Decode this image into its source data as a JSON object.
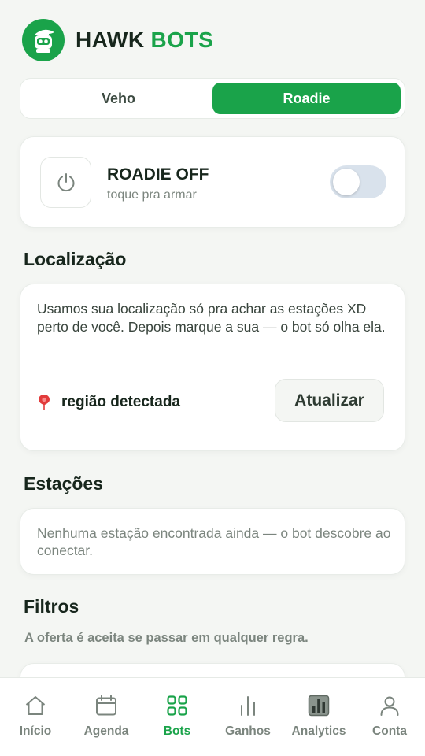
{
  "brand": {
    "name_part1": "HAWK",
    "name_part2": "BOTS",
    "logo_icon": "robot-hawk-icon"
  },
  "tabs": [
    {
      "label": "Veho",
      "active": false
    },
    {
      "label": "Roadie",
      "active": true
    }
  ],
  "power": {
    "title": "ROADIE OFF",
    "subtitle": "toque pra armar",
    "toggle_on": false,
    "icon": "power-icon"
  },
  "location": {
    "title": "Localização",
    "description": "Usamos sua localização só pra achar as estações XD perto de você. Depois marque a sua — o bot só olha ela.",
    "region": "região detectada",
    "update_label": "Atualizar"
  },
  "stations": {
    "title": "Estações",
    "empty_text": "Nenhuma estação encontrada ainda — o bot descobre ao conectar."
  },
  "filters": {
    "title": "Filtros",
    "subtitle": "A oferta é aceita se passar em qualquer regra."
  },
  "nav": [
    {
      "label": "Início",
      "icon": "home-icon",
      "active": false
    },
    {
      "label": "Agenda",
      "icon": "calendar-icon",
      "active": false
    },
    {
      "label": "Bots",
      "icon": "grid-icon",
      "active": true
    },
    {
      "label": "Ganhos",
      "icon": "bars-icon",
      "active": false
    },
    {
      "label": "Analytics",
      "icon": "analytics-icon",
      "active": false
    },
    {
      "label": "Conta",
      "icon": "user-icon",
      "active": false
    }
  ],
  "colors": {
    "accent": "#1aa34a",
    "background": "#f4f6f3",
    "text": "#17261c",
    "muted": "#7b857e",
    "toggle_off": "#d9e2ec"
  }
}
